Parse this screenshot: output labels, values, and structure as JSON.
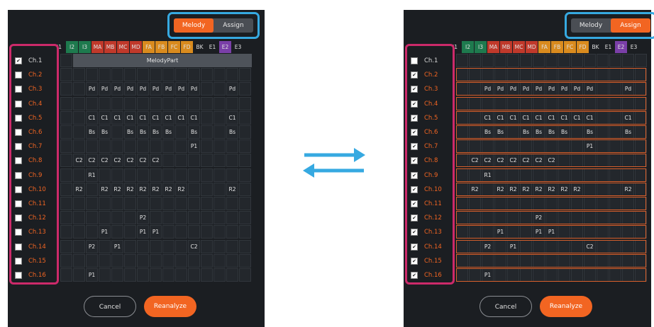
{
  "toggle": {
    "melody": "Melody",
    "assign": "Assign"
  },
  "columns": [
    {
      "label": "I1",
      "color": "#1b1e22"
    },
    {
      "label": "I2",
      "color": "#1e7a4e"
    },
    {
      "label": "I3",
      "color": "#1e7a4e"
    },
    {
      "label": "MA",
      "color": "#c0392b"
    },
    {
      "label": "MB",
      "color": "#c0392b"
    },
    {
      "label": "MC",
      "color": "#c0392b"
    },
    {
      "label": "MD",
      "color": "#c0392b"
    },
    {
      "label": "FA",
      "color": "#d98b1e"
    },
    {
      "label": "FB",
      "color": "#d98b1e"
    },
    {
      "label": "FC",
      "color": "#d98b1e"
    },
    {
      "label": "FD",
      "color": "#d98b1e"
    },
    {
      "label": "BK",
      "color": "#1b1e22"
    },
    {
      "label": "E1",
      "color": "#1b1e22"
    },
    {
      "label": "E2",
      "color": "#7a3fa8"
    },
    {
      "label": "E3",
      "color": "#1b1e22"
    }
  ],
  "channels": [
    "Ch.1",
    "Ch.2",
    "Ch.3",
    "Ch.4",
    "Ch.5",
    "Ch.6",
    "Ch.7",
    "Ch.8",
    "Ch.9",
    "Ch.10",
    "Ch.11",
    "Ch.12",
    "Ch.13",
    "Ch.14",
    "Ch.15",
    "Ch.16"
  ],
  "left_checked": [
    true,
    false,
    false,
    false,
    false,
    false,
    false,
    false,
    false,
    false,
    false,
    false,
    false,
    false,
    false,
    false
  ],
  "right_checked": [
    false,
    true,
    true,
    true,
    true,
    true,
    true,
    true,
    true,
    true,
    true,
    true,
    true,
    true,
    true,
    true
  ],
  "melody_part_label": "MelodyPart",
  "grid": [
    [
      "",
      "",
      "",
      "",
      "",
      "",
      "",
      "",
      "",
      "",
      "",
      "",
      "",
      "",
      ""
    ],
    [
      "",
      "",
      "",
      "",
      "",
      "",
      "",
      "",
      "",
      "",
      "",
      "",
      "",
      "",
      ""
    ],
    [
      "",
      "",
      "Pd",
      "Pd",
      "Pd",
      "Pd",
      "Pd",
      "Pd",
      "Pd",
      "Pd",
      "Pd",
      "",
      "",
      "Pd",
      ""
    ],
    [
      "",
      "",
      "",
      "",
      "",
      "",
      "",
      "",
      "",
      "",
      "",
      "",
      "",
      "",
      ""
    ],
    [
      "",
      "",
      "C1",
      "C1",
      "C1",
      "C1",
      "C1",
      "C1",
      "C1",
      "C1",
      "C1",
      "",
      "",
      "C1",
      ""
    ],
    [
      "",
      "",
      "Bs",
      "Bs",
      "",
      "Bs",
      "Bs",
      "Bs",
      "Bs",
      "",
      "Bs",
      "",
      "",
      "Bs",
      ""
    ],
    [
      "",
      "",
      "",
      "",
      "",
      "",
      "",
      "",
      "",
      "",
      "P1",
      "",
      "",
      "",
      ""
    ],
    [
      "",
      "C2",
      "C2",
      "C2",
      "C2",
      "C2",
      "C2",
      "C2",
      "",
      "",
      "",
      "",
      "",
      "",
      ""
    ],
    [
      "",
      "",
      "R1",
      "",
      "",
      "",
      "",
      "",
      "",
      "",
      "",
      "",
      "",
      "",
      ""
    ],
    [
      "",
      "R2",
      "",
      "R2",
      "R2",
      "R2",
      "R2",
      "R2",
      "R2",
      "R2",
      "",
      "",
      "",
      "R2",
      ""
    ],
    [
      "",
      "",
      "",
      "",
      "",
      "",
      "",
      "",
      "",
      "",
      "",
      "",
      "",
      "",
      ""
    ],
    [
      "",
      "",
      "",
      "",
      "",
      "",
      "P2",
      "",
      "",
      "",
      "",
      "",
      "",
      "",
      ""
    ],
    [
      "",
      "",
      "",
      "P1",
      "",
      "",
      "P1",
      "P1",
      "",
      "",
      "",
      "",
      "",
      "",
      ""
    ],
    [
      "",
      "",
      "P2",
      "",
      "P1",
      "",
      "",
      "",
      "",
      "",
      "C2",
      "",
      "",
      "",
      ""
    ],
    [
      "",
      "",
      "",
      "",
      "",
      "",
      "",
      "",
      "",
      "",
      "",
      "",
      "",
      "",
      ""
    ],
    [
      "",
      "",
      "P1",
      "",
      "",
      "",
      "",
      "",
      "",
      "",
      "",
      "",
      "",
      "",
      ""
    ]
  ],
  "buttons": {
    "cancel": "Cancel",
    "reanalyze": "Reanalyze"
  }
}
